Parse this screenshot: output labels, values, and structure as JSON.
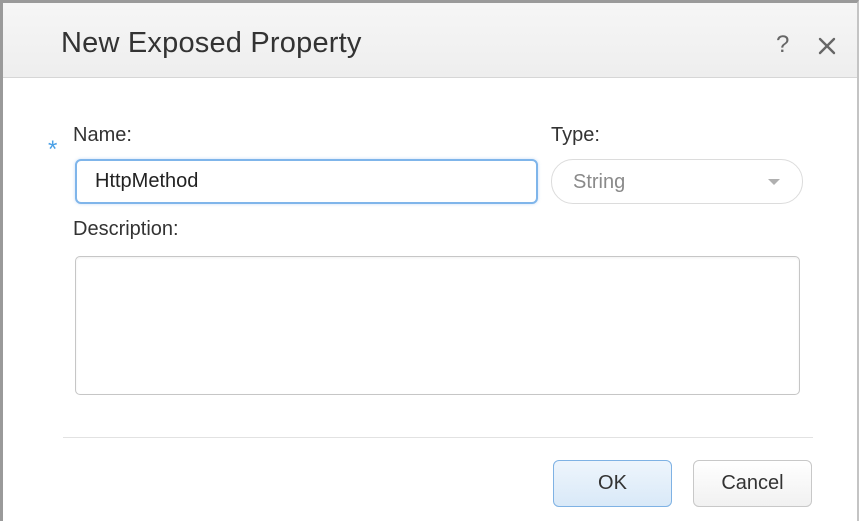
{
  "dialog": {
    "title": "New Exposed Property",
    "help_glyph": "?",
    "icons": {
      "help": "help-icon",
      "close": "close-icon",
      "required": "required-icon",
      "dropdown": "chevron-down-icon"
    }
  },
  "form": {
    "required_marker": "*",
    "name_label": "Name:",
    "name_value": "HttpMethod",
    "type_label": "Type:",
    "type_value": "String",
    "description_label": "Description:",
    "description_value": ""
  },
  "buttons": {
    "ok_label": "OK",
    "cancel_label": "Cancel"
  },
  "colors": {
    "accent": "#7fb5ea",
    "required": "#4aa0e6"
  }
}
